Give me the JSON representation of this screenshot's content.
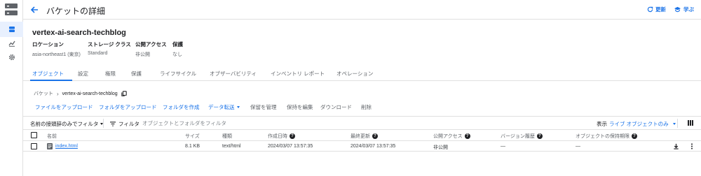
{
  "header": {
    "title": "バケットの詳細",
    "refresh_label": "更新",
    "learn_label": "学ぶ"
  },
  "bucket": {
    "name": "vertex-ai-search-techblog",
    "meta": [
      {
        "label": "ロケーション",
        "value": "asia-northeast1 (東京)"
      },
      {
        "label": "ストレージ クラス",
        "value": "Standard"
      },
      {
        "label": "公開アクセス",
        "value": "非公開"
      },
      {
        "label": "保護",
        "value": "なし"
      }
    ]
  },
  "tabs": [
    "オブジェクト",
    "設定",
    "権限",
    "保護",
    "ライフサイクル",
    "オブザーバビリティ",
    "インベントリ レポート",
    "オペレーション"
  ],
  "breadcrumb": {
    "root": "バケット",
    "current": "vertex-ai-search-techblog"
  },
  "actions": {
    "upload_file": "ファイルをアップロード",
    "upload_folder": "フォルダをアップロード",
    "create_folder": "フォルダを作成",
    "transfer_data": "データ転送",
    "manage_holds": "保留を管理",
    "edit_access": "保持を編集",
    "download": "ダウンロード",
    "delete": "削除"
  },
  "filter": {
    "prefix_label": "名前の接頭辞のみでフィルタ",
    "filter_label": "フィルタ",
    "placeholder": "オブジェクトとフォルダをフィルタ",
    "show_label": "表示",
    "show_value": "ライブ オブジェクトのみ"
  },
  "table": {
    "columns": [
      "名前",
      "サイズ",
      "種類",
      "作成日時",
      "最終更新",
      "公開アクセス",
      "バージョン履歴",
      "オブジェクトの保持期限"
    ],
    "rows": [
      {
        "name": "index.html",
        "size": "8.1 KB",
        "type": "text/html",
        "created": "2024/03/07 13:57:35",
        "updated": "2024/03/07 13:57:35",
        "public_access": "非公開",
        "version_history": "—",
        "retention": "—"
      }
    ]
  },
  "colors": {
    "accent": "#1a73e8",
    "text": "#202124",
    "muted": "#5f6368",
    "border": "#e0e0e0"
  }
}
